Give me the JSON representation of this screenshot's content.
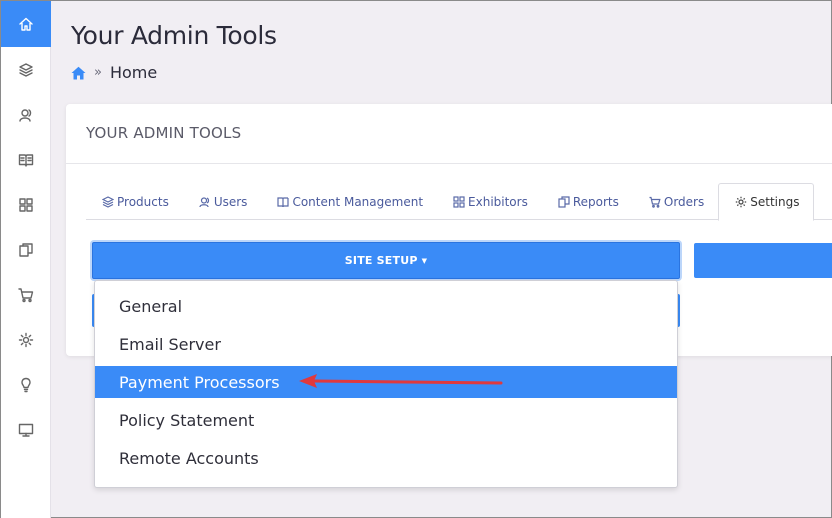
{
  "page": {
    "title": "Your Admin Tools",
    "breadcrumb": {
      "home_icon": "home-icon",
      "current": "Home"
    }
  },
  "sidebar": {
    "items": [
      {
        "icon": "home-icon",
        "active": true
      },
      {
        "icon": "layers-icon",
        "active": false
      },
      {
        "icon": "users-icon",
        "active": false
      },
      {
        "icon": "book-icon",
        "active": false
      },
      {
        "icon": "grid-icon",
        "active": false
      },
      {
        "icon": "copy-icon",
        "active": false
      },
      {
        "icon": "cart-icon",
        "active": false
      },
      {
        "icon": "gear-icon",
        "active": false
      },
      {
        "icon": "lightbulb-icon",
        "active": false
      },
      {
        "icon": "monitor-icon",
        "active": false
      }
    ]
  },
  "card": {
    "header": "YOUR ADMIN TOOLS",
    "tabs": [
      {
        "label": "Products",
        "icon": "layers-icon"
      },
      {
        "label": "Users",
        "icon": "users-icon"
      },
      {
        "label": "Content Management",
        "icon": "book-icon"
      },
      {
        "label": "Exhibitors",
        "icon": "grid-icon"
      },
      {
        "label": "Reports",
        "icon": "copy-icon"
      },
      {
        "label": "Orders",
        "icon": "cart-icon"
      },
      {
        "label": "Settings",
        "icon": "gear-icon",
        "active": true
      }
    ],
    "site_setup_label": "SITE SETUP",
    "dropdown": [
      {
        "label": "General"
      },
      {
        "label": "Email Server"
      },
      {
        "label": "Payment Processors",
        "active": true
      },
      {
        "label": "Policy Statement"
      },
      {
        "label": "Remote Accounts"
      }
    ]
  },
  "colors": {
    "accent": "#3a8bf7",
    "annotation_arrow": "#e0393e",
    "background": "#f1eef3"
  }
}
